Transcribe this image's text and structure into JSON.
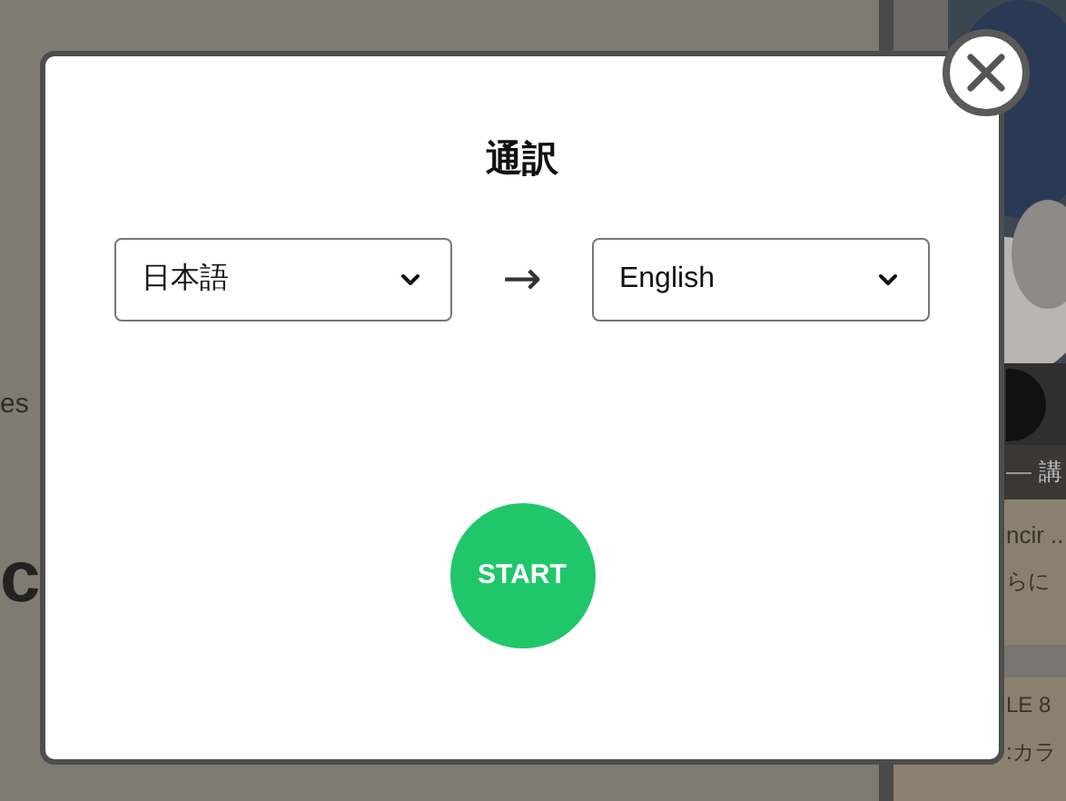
{
  "background": {
    "left_texts": [
      "es",
      "c"
    ],
    "right_texts": [
      "講",
      "ncir ..",
      "らに",
      "LE 8",
      ":カラ"
    ]
  },
  "dialog": {
    "title": "通訳",
    "source_language": "日本語",
    "arrow": "→",
    "target_language": "English",
    "start_button": "START"
  }
}
